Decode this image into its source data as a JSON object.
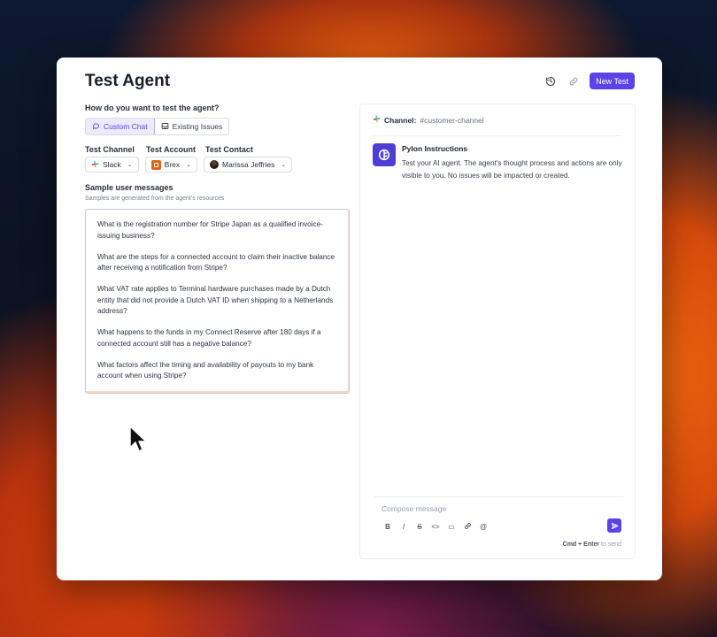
{
  "header": {
    "title": "Test Agent",
    "new_test_label": "New Test",
    "history_icon": "history-icon",
    "link_icon": "link-icon"
  },
  "mode": {
    "question": "How do you want to test the agent?",
    "options": [
      "Custom Chat",
      "Existing Issues"
    ],
    "selected": "Custom Chat"
  },
  "fields": {
    "channel_label": "Test Channel",
    "account_label": "Test Account",
    "contact_label": "Test Contact",
    "channel_value": "Slack",
    "account_value": "Brex",
    "contact_value": "Marissa Jeffries"
  },
  "samples": {
    "title": "Sample user messages",
    "subtitle": "Samples are generated from the agent's resources",
    "items": [
      "What is the registration number for Stripe Japan as a qualified invoice-issuing business?",
      "What are the steps for a connected account to claim their inactive balance after receiving a notification from Stripe?",
      "What VAT rate applies to Terminal hardware purchases made by a Dutch entity that did not provide a Dutch VAT ID when shipping to a Netherlands address?",
      "What happens to the funds in my Connect Reserve after 180 days if a connected account still has a negative balance?",
      "What factors affect the timing and availability of payouts to my bank account when using Stripe?"
    ]
  },
  "chat": {
    "channel_label": "Channel:",
    "channel_value": "#customer-channel",
    "message_title": "Pylon Instructions",
    "message_body": "Test your AI agent. The agent's thought process and actions are only visible to you. No issues will be impacted or created.",
    "composer_placeholder": "Compose message",
    "send_hint_keys": "Cmd + Enter",
    "send_hint_text": "to send",
    "format_tools": [
      "B",
      "I",
      "S",
      "<>",
      "▭",
      "🔗",
      "@"
    ]
  },
  "colors": {
    "accent": "#5b43e8",
    "brex": "#e3621b"
  }
}
